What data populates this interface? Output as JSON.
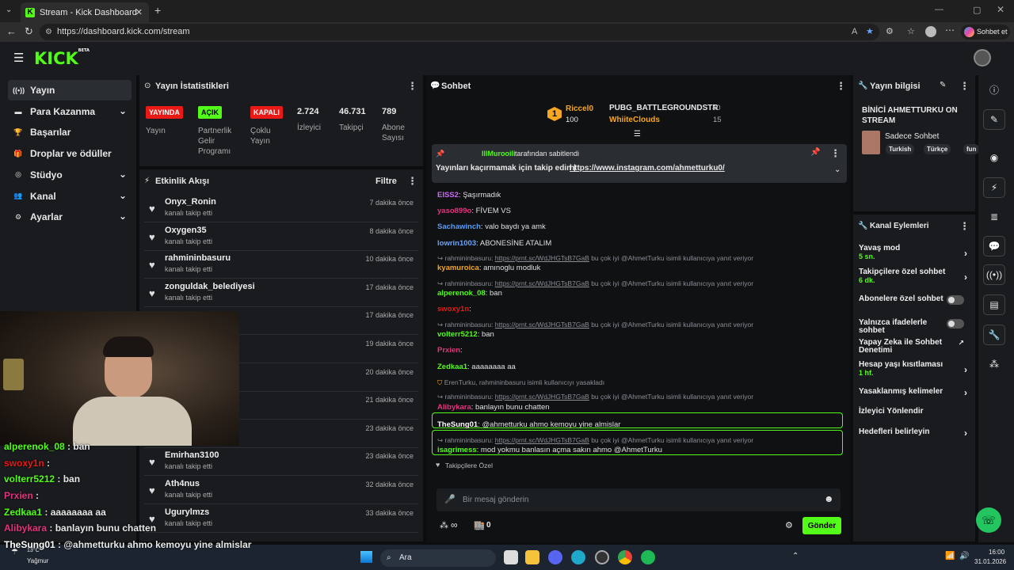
{
  "browser": {
    "tab_title": "Stream - Kick Dashboard",
    "url": "https://dashboard.kick.com/stream",
    "chat_button": "Sohbet et",
    "reader_icon": "A"
  },
  "logo": {
    "text": "KICK",
    "beta": "BETA"
  },
  "sidebar": {
    "items": [
      {
        "label": "Yayın",
        "icon": "broadcast-icon",
        "chevron": false
      },
      {
        "label": "Para Kazanma",
        "icon": "money-icon",
        "chevron": true
      },
      {
        "label": "Başarılar",
        "icon": "trophy-icon",
        "chevron": false
      },
      {
        "label": "Droplar ve ödüller",
        "icon": "gift-icon",
        "chevron": false
      },
      {
        "label": "Stüdyo",
        "icon": "studio-icon",
        "chevron": true
      },
      {
        "label": "Kanal",
        "icon": "users-icon",
        "chevron": true
      },
      {
        "label": "Ayarlar",
        "icon": "gear-icon",
        "chevron": true
      }
    ]
  },
  "stats": {
    "title": "Yayın İstatistikleri",
    "items": [
      {
        "badge": "YAYINDA",
        "badge_color": "#e91916",
        "label": "Yayın"
      },
      {
        "badge": "AÇIK",
        "badge_color": "#53fc18",
        "label": "Partnerlik Gelir Programı"
      },
      {
        "badge": "KAPALI",
        "badge_color": "#e91916",
        "label": "Çoklu Yayın"
      },
      {
        "value": "2.724",
        "label": "İzleyici"
      },
      {
        "value": "46.731",
        "label": "Takipçi"
      },
      {
        "value": "789",
        "label": "Abone Sayısı"
      }
    ]
  },
  "activity": {
    "title": "Etkinlik Akışı",
    "filter": "Filtre",
    "rows": [
      {
        "name": "Onyx_Ronin",
        "sub": "kanalı takip etti",
        "time": "7 dakika önce"
      },
      {
        "name": "Oxygen35",
        "sub": "kanalı takip etti",
        "time": "8 dakika önce"
      },
      {
        "name": "rahmininbasuru",
        "sub": "kanalı takip etti",
        "time": "10 dakika önce"
      },
      {
        "name": "zonguldak_belediyesi",
        "sub": "kanalı takip etti",
        "time": "17 dakika önce"
      },
      {
        "name": "",
        "sub": "",
        "time": "17 dakika önce"
      },
      {
        "name": "",
        "sub": "",
        "time": "19 dakika önce"
      },
      {
        "name": "",
        "sub": "",
        "time": "20 dakika önce"
      },
      {
        "name": "",
        "sub": "",
        "time": "21 dakika önce"
      },
      {
        "name": "",
        "sub": "",
        "time": "23 dakika önce"
      },
      {
        "name": "Emirhan3100",
        "sub": "kanalı takip etti",
        "time": "23 dakika önce"
      },
      {
        "name": "Ath4nus",
        "sub": "kanalı takip etti",
        "time": "32 dakika önce"
      },
      {
        "name": "Ugurylmzs",
        "sub": "kanalı takip etti",
        "time": "33 dakika önce"
      }
    ]
  },
  "chat": {
    "title": "Sohbet",
    "leaderboard": [
      {
        "rank": "1",
        "name": "Riccel0",
        "amount": "100",
        "color": "#f5a623"
      },
      {
        "name": "PUBG_BATTLEGROUNDSTR",
        "amount": "40",
        "color": "#ffffff"
      },
      {
        "name": "WhiiteClouds",
        "amount": "15",
        "color": "#f5a623"
      }
    ],
    "pinned": {
      "by": "IllMurooili",
      "by_suffix": "tarafından sabitlendi",
      "text": "Yayınları kaçırmamak için takip edin | ",
      "link": "https://www.instagram.com/ahmetturku0/"
    },
    "messages": [
      {
        "user": "EISS2",
        "color": "#c76cf0",
        "text": ": Şaşırmadık"
      },
      {
        "user": "yaso899o",
        "color": "#e5337e",
        "text": ": FİVEM VS"
      },
      {
        "user": "Sachawinch",
        "color": "#5b9cf5",
        "text": ": valo baydı ya amk"
      },
      {
        "user": "lowrin1003",
        "color": "#6aa4ff",
        "text": ": ABONESİNE ATALIM"
      },
      {
        "reply": "rahmininbasuru: ",
        "reply_link": "https://prnt.sc/WdJHGTsB7GaB",
        "reply_rest": " bu çok iyi @AhmetTurku isimli kullanıcıya yanıt veriyor"
      },
      {
        "user": "kyamuroica",
        "color": "#f5a623",
        "text": ": amınoglu modluk"
      },
      {
        "reply": "rahmininbasuru: ",
        "reply_link": "https://prnt.sc/WdJHGTsB7GaB",
        "reply_rest": " bu çok iyi @AhmetTurku isimli kullanıcıya yanıt veriyor"
      },
      {
        "user": "alperenok_08",
        "color": "#53fc18",
        "text": ": ban"
      },
      {
        "user": "swoxy1n",
        "color": "#e91916",
        "text": ":"
      },
      {
        "reply": "rahmininbasuru: ",
        "reply_link": "https://prnt.sc/WdJHGTsB7GaB",
        "reply_rest": " bu çok iyi @AhmetTurku isimli kullanıcıya yanıt veriyor"
      },
      {
        "user": "volterr5212",
        "color": "#53fc18",
        "text": ": ban"
      },
      {
        "user": "Prxien",
        "color": "#e5337e",
        "text": ":"
      },
      {
        "user": "Zedkaa1",
        "color": "#53fc18",
        "text": ": aaaaaaaa aa"
      },
      {
        "system": "ErenTurku, rahmininbasuru isimli kullanıcıyı yasakladı"
      },
      {
        "reply": "rahmininbasuru: ",
        "reply_link": "https://prnt.sc/WdJHGTsB7GaB",
        "reply_rest": " bu çok iyi @AhmetTurku isimli kullanıcıya yanıt veriyor"
      },
      {
        "user": "Alibykara",
        "color": "#e5337e",
        "text": ": banlayın bunu chatten"
      },
      {
        "user": "TheSung01",
        "color": "#ffffff",
        "text": ": @ahmetturku ahmo kemoyu yine almislar"
      },
      {
        "reply": "rahmininbasuru: ",
        "reply_link": "https://prnt.sc/WdJHGTsB7GaB",
        "reply_rest": " bu çok iyi @AhmetTurku isimli kullanıcıya yanıt veriyor"
      },
      {
        "user": "isagrimess",
        "color": "#53fc18",
        "text": ": mod yokmu banlasın açma sakın ahmo @AhmetTurku"
      }
    ],
    "followers_only": "Takipçilere Özel",
    "placeholder": "Bir mesaj gönderin",
    "points": "0",
    "send": "Gönder"
  },
  "stream_info": {
    "title": "Yayın bilgisi",
    "stream_title": "BİNİCİ AHMETTURKU ON STREAM",
    "category": "Sadece Sohbet",
    "tags": [
      "Turkish",
      "Türkçe",
      "fun"
    ]
  },
  "actions": {
    "title": "Kanal Eylemleri",
    "items": [
      {
        "label": "Yavaş mod",
        "value": "5 sn.",
        "ctrl": "chevron"
      },
      {
        "label": "Takipçilere özel sohbet",
        "value": "6 dk.",
        "ctrl": "chevron"
      },
      {
        "label": "Abonelere özel sohbet",
        "ctrl": "toggle"
      },
      {
        "label": "Yalnızca ifadelerle sohbet",
        "ctrl": "toggle"
      },
      {
        "label": "Yapay Zeka ile Sohbet Denetimi",
        "ctrl": "external"
      },
      {
        "label": "Hesap yaşı kısıtlaması",
        "value": "1 hf.",
        "ctrl": "chevron"
      },
      {
        "label": "Yasaklanmış kelimeler",
        "ctrl": "chevron"
      },
      {
        "label": "İzleyici Yönlendir",
        "ctrl": "none"
      },
      {
        "label": "Hedefleri belirleyin",
        "ctrl": "chevron"
      }
    ]
  },
  "overlay_chat": [
    {
      "user": "alperenok_08",
      "color": "#53fc18",
      "text": " : ban"
    },
    {
      "user": "swoxy1n",
      "color": "#e91916",
      "text": " :"
    },
    {
      "user": "volterr5212",
      "color": "#53fc18",
      "text": " : ban"
    },
    {
      "user": "Prxien",
      "color": "#e5337e",
      "text": " :"
    },
    {
      "user": "Zedkaa1",
      "color": "#53fc18",
      "text": " : aaaaaaaa aa"
    },
    {
      "user": "Alibykara",
      "color": "#e5337e",
      "text": " : banlayın bunu chatten"
    },
    {
      "user": "TheSung01",
      "color": "#ffffff",
      "text": " : @ahmetturku ahmo kemoyu yine almislar"
    }
  ],
  "taskbar": {
    "weather_temp": "13°C",
    "weather_desc": "Yağmur",
    "search": "Ara",
    "time": "16:00",
    "date": "31.01.2026"
  }
}
